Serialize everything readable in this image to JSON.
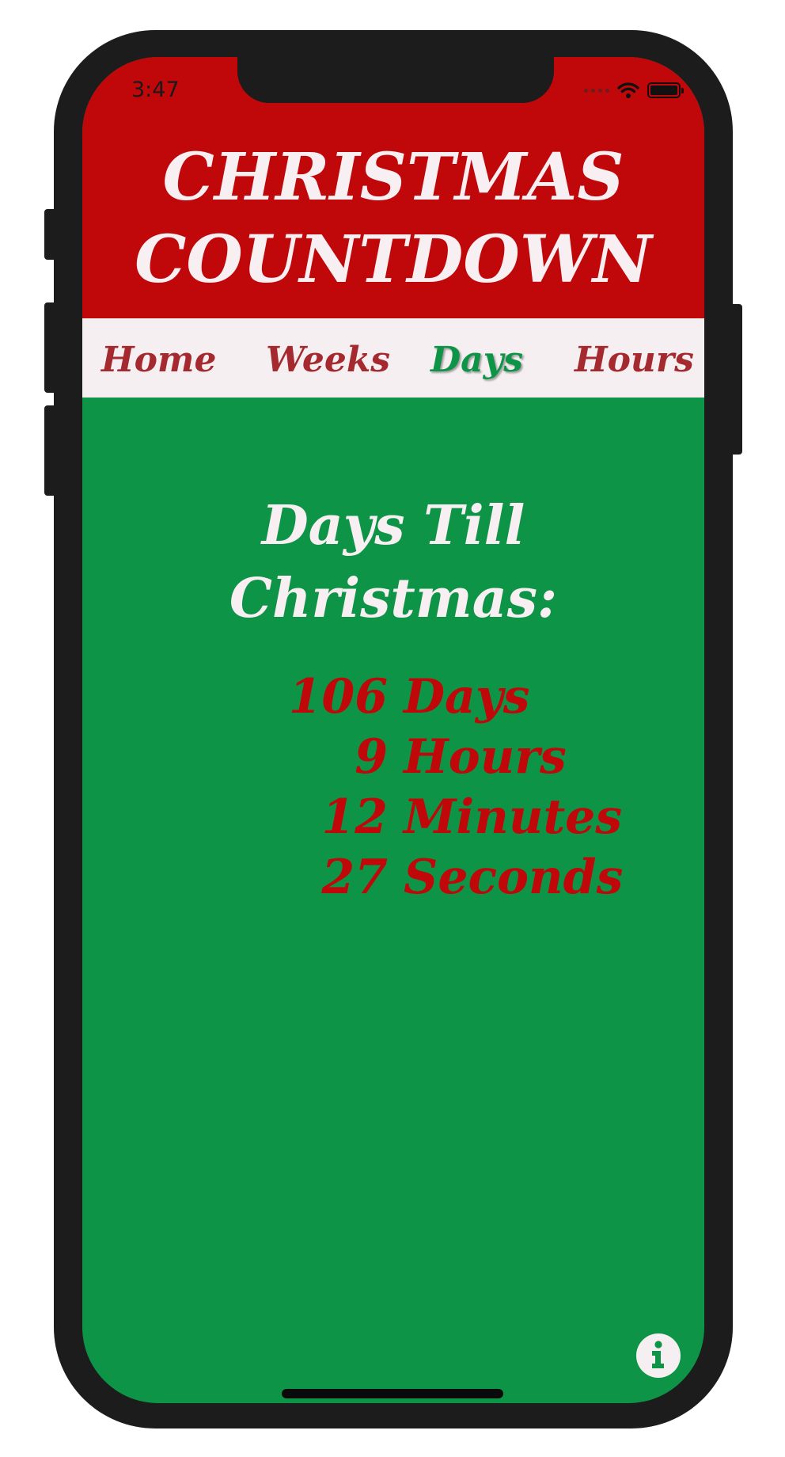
{
  "status_bar": {
    "time": "3:47"
  },
  "app": {
    "title_line1": "CHRISTMAS",
    "title_line2": "COUNTDOWN"
  },
  "nav": {
    "items": [
      {
        "label": "Home"
      },
      {
        "label": "Weeks"
      },
      {
        "label": "Days",
        "active": true
      },
      {
        "label": "Hours"
      }
    ]
  },
  "main": {
    "heading_line1": "Days Till",
    "heading_line2": "Christmas:",
    "countdown": [
      {
        "value": "106",
        "unit": "Days"
      },
      {
        "value": "9",
        "unit": "Hours"
      },
      {
        "value": "12",
        "unit": "Minutes"
      },
      {
        "value": "27",
        "unit": "Seconds"
      }
    ]
  },
  "icons": {
    "info": "info-icon",
    "wifi": "wifi-icon",
    "battery": "battery-icon"
  },
  "colors": {
    "header_red": "#c0070a",
    "background_green": "#0e9447",
    "nav_background": "#f5eff1",
    "nav_text": "#a52a2f",
    "title_text": "#f7eff2"
  }
}
